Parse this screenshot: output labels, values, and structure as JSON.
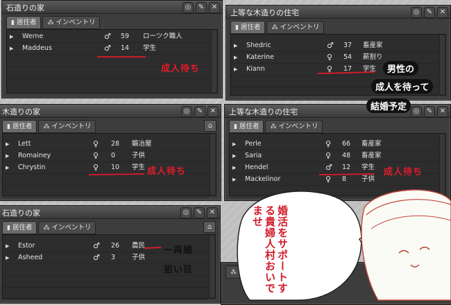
{
  "tabs": {
    "residents": "居住者",
    "inventory": "インベントリ"
  },
  "panels": [
    {
      "title": "石造りの家",
      "rows": [
        {
          "name": "Werne",
          "sex": "♂",
          "age": "59",
          "job": "ローツク職人"
        },
        {
          "name": "Maddeus",
          "sex": "♂",
          "age": "14",
          "job": "学生"
        }
      ]
    },
    {
      "title": "上等な木造りの住宅",
      "rows": [
        {
          "name": "Shedric",
          "sex": "♂",
          "age": "37",
          "job": "畜産家"
        },
        {
          "name": "Katerine",
          "sex": "♀",
          "age": "54",
          "job": "薪割り"
        },
        {
          "name": "Kiann",
          "sex": "♀",
          "age": "17",
          "job": "学生"
        }
      ]
    },
    {
      "title": "木造りの家",
      "rows": [
        {
          "name": "Lett",
          "sex": "♀",
          "age": "28",
          "job": "鍛冶屋"
        },
        {
          "name": "Romainey",
          "sex": "♀",
          "age": "0",
          "job": "子供"
        },
        {
          "name": "Chrystin",
          "sex": "♀",
          "age": "10",
          "job": "学生"
        }
      ]
    },
    {
      "title": "上等な木造りの住宅",
      "rows": [
        {
          "name": "Perle",
          "sex": "♀",
          "age": "66",
          "job": "畜産家"
        },
        {
          "name": "Saria",
          "sex": "♀",
          "age": "48",
          "job": "畜産家"
        },
        {
          "name": "Hendel",
          "sex": "♂",
          "age": "12",
          "job": "学生"
        },
        {
          "name": "Mackelinor",
          "sex": "♀",
          "age": "8",
          "job": "子供"
        }
      ]
    },
    {
      "title": "石造りの家",
      "rows": [
        {
          "name": "Estor",
          "sex": "♂",
          "age": "26",
          "job": "農民"
        },
        {
          "name": "Asheed",
          "sex": "♂",
          "age": "3",
          "job": "子供"
        }
      ]
    }
  ],
  "annotations": {
    "wait_adult_1": "成人待ち",
    "wait_adult_2": "成人待ち",
    "wait_adult_3": "成人待ち",
    "male_line1": "男性の",
    "male_line2": "成人を待って",
    "male_line3": "結婚予定",
    "remarry_line1": "一再婚",
    "remarry_line2": "狙い目",
    "bubble": "婚活をサポートする貴婦人村おいでませ"
  },
  "colors": {
    "annotation_red": "#e21b2b",
    "panel_bg": "#3d3d3d"
  }
}
